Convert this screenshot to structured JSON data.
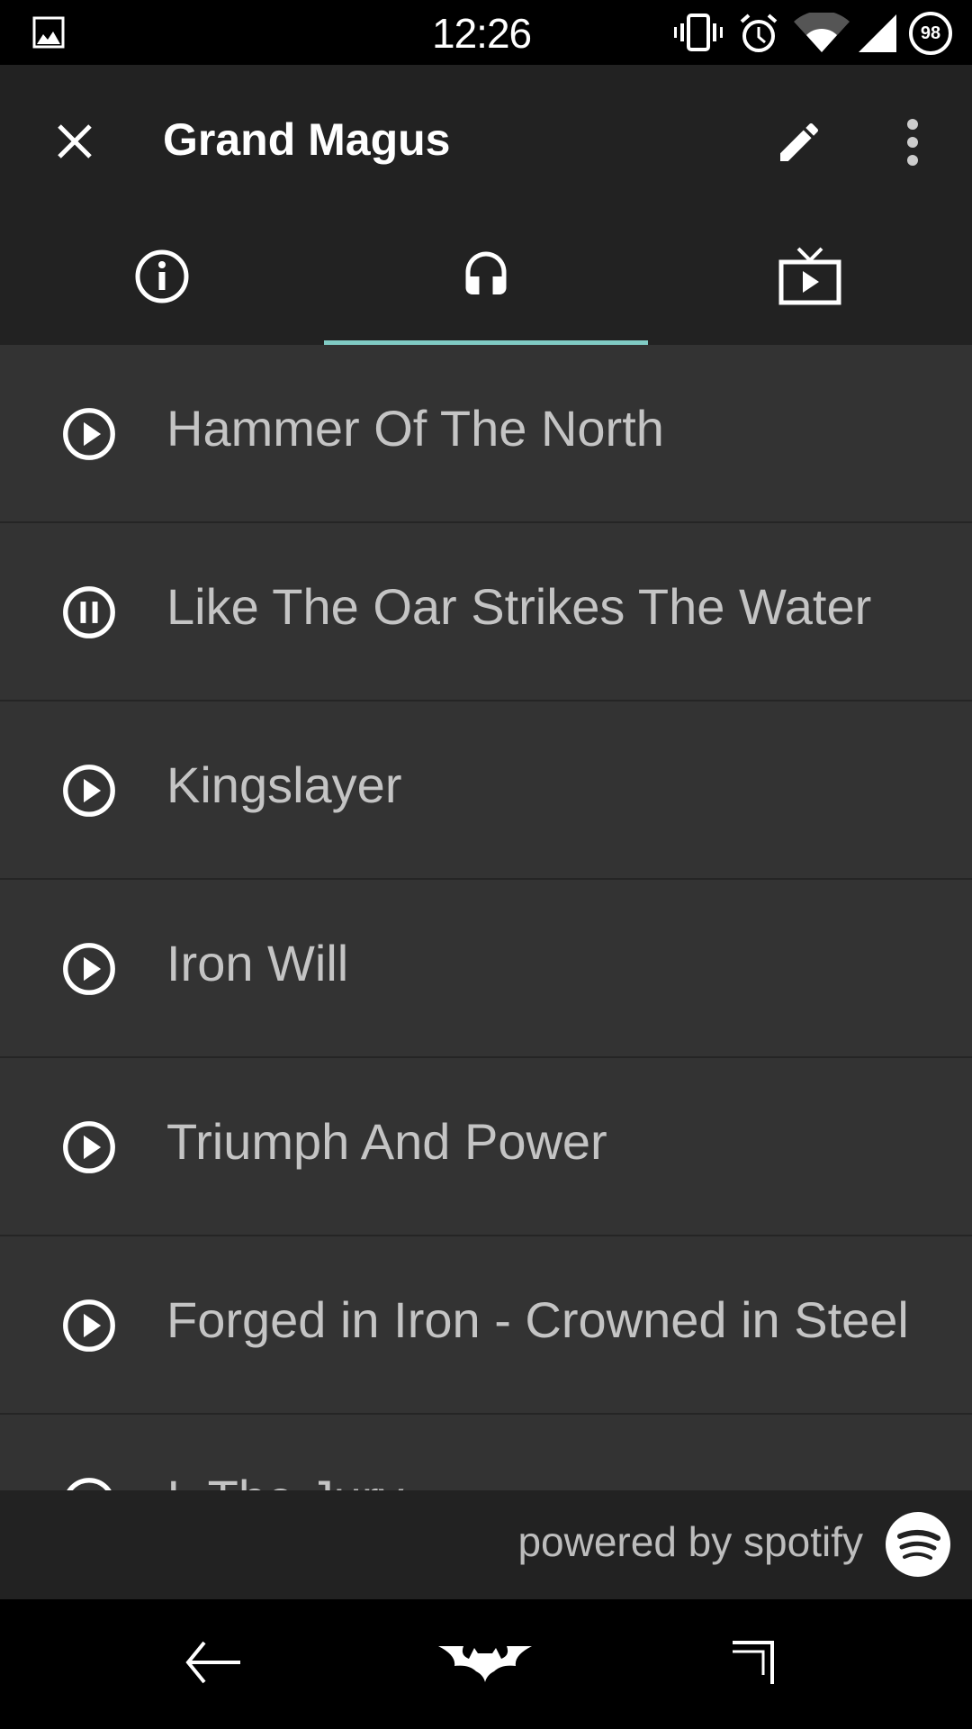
{
  "status_bar": {
    "time": "12:26",
    "battery": "98",
    "icons": [
      "image-icon",
      "vibrate-icon",
      "alarm-icon",
      "wifi-icon",
      "signal-icon",
      "battery-icon"
    ]
  },
  "toolbar": {
    "title": "Grand Magus",
    "icons": [
      "close-icon",
      "edit-icon",
      "more-vert-icon"
    ]
  },
  "tabs": [
    {
      "icon": "info-icon",
      "active": false
    },
    {
      "icon": "headphones-icon",
      "active": true
    },
    {
      "icon": "tv-play-icon",
      "active": false
    }
  ],
  "accent_color": "#80cbc4",
  "tracks": [
    {
      "title": "Hammer Of The North",
      "state": "play"
    },
    {
      "title": "Like The Oar Strikes The Water",
      "state": "pause"
    },
    {
      "title": "Kingslayer",
      "state": "play"
    },
    {
      "title": "Iron Will",
      "state": "play"
    },
    {
      "title": "Triumph And Power",
      "state": "play"
    },
    {
      "title": "Forged in Iron - Crowned in Steel",
      "state": "play"
    },
    {
      "title": "I, The Jury",
      "state": "play"
    }
  ],
  "footer": {
    "text": "powered by spotify",
    "logo": "spotify-logo"
  },
  "nav_bar": {
    "icons": [
      "back-icon",
      "home-icon",
      "recents-icon"
    ]
  }
}
